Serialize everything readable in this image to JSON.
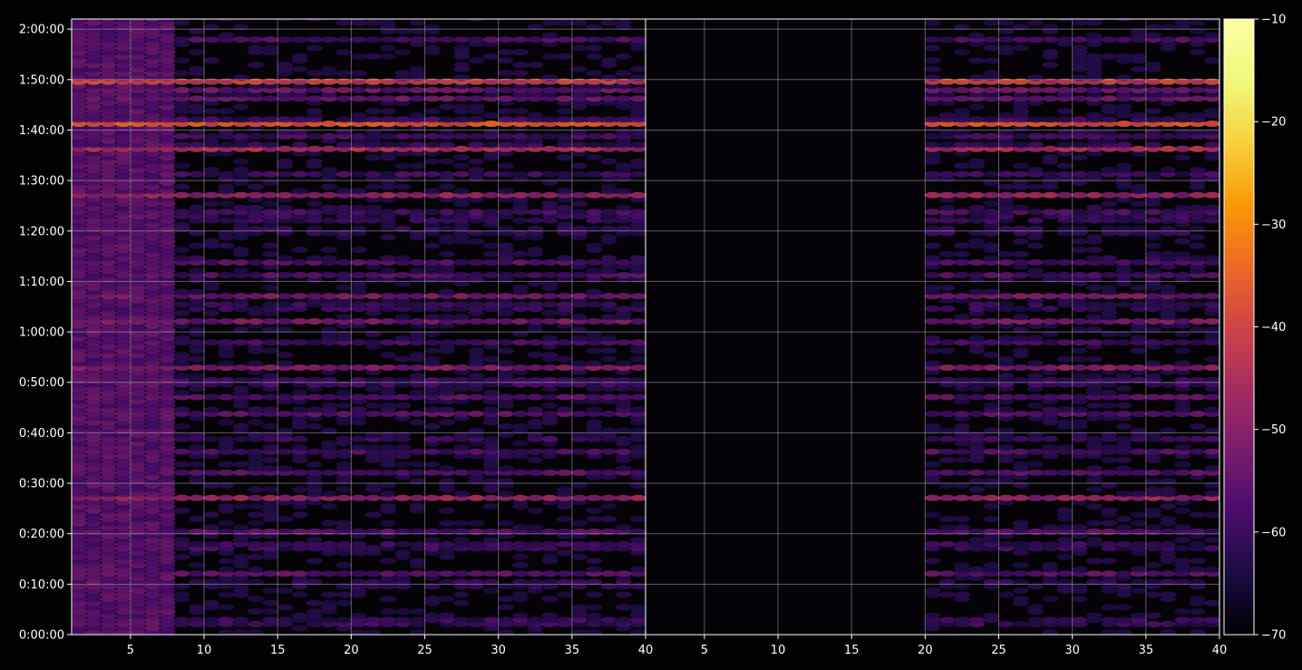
{
  "chart_data": {
    "type": "heatmap",
    "title": "",
    "xlabel": "",
    "ylabel": "",
    "colormap": "inferno",
    "background": "#000000",
    "grid": true,
    "panels": [
      {
        "name": "",
        "xlim": [
          1,
          40
        ],
        "x_ticks": [
          5,
          10,
          15,
          20,
          25,
          30,
          35,
          40
        ],
        "x_tick_labels": [
          "5",
          "10",
          "15",
          "20",
          "25",
          "30",
          "35",
          "40"
        ],
        "active_x_start": 1
      },
      {
        "name": "",
        "xlim": [
          1,
          40
        ],
        "x_ticks": [
          5,
          10,
          15,
          20,
          25,
          30,
          35,
          40
        ],
        "x_tick_labels": [
          "5",
          "10",
          "15",
          "20",
          "25",
          "30",
          "35",
          "40"
        ],
        "active_x_start": 20
      }
    ],
    "ylim_seconds": [
      0,
      7320
    ],
    "y_ticks_seconds": [
      0,
      600,
      1200,
      1800,
      2400,
      3000,
      3600,
      4200,
      4800,
      5400,
      6000,
      6600,
      7200
    ],
    "y_tick_labels": [
      "0:00:00",
      "0:10:00",
      "0:20:00",
      "0:30:00",
      "0:40:00",
      "0:50:00",
      "1:00:00",
      "1:10:00",
      "1:20:00",
      "1:30:00",
      "1:40:00",
      "1:50:00",
      "2:00:00"
    ],
    "colorbar": {
      "range": [
        -70,
        -10
      ],
      "ticks": [
        -70,
        -60,
        -50,
        -40,
        -30,
        -20,
        -10
      ],
      "tick_labels": [
        "−70",
        "−60",
        "−50",
        "−40",
        "−30",
        "−20",
        "−10"
      ]
    },
    "bands": [
      {
        "time": "0:02:30",
        "value": -52
      },
      {
        "time": "0:10:00",
        "value": -58
      },
      {
        "time": "0:12:00",
        "value": -55
      },
      {
        "time": "0:17:30",
        "value": -52
      },
      {
        "time": "0:20:30",
        "value": -56
      },
      {
        "time": "0:27:00",
        "value": -46
      },
      {
        "time": "0:32:00",
        "value": -55
      },
      {
        "time": "0:36:00",
        "value": -53
      },
      {
        "time": "0:39:00",
        "value": -58
      },
      {
        "time": "0:44:00",
        "value": -51
      },
      {
        "time": "0:47:00",
        "value": -56
      },
      {
        "time": "0:50:00",
        "value": -52
      },
      {
        "time": "0:53:00",
        "value": -49
      },
      {
        "time": "0:58:00",
        "value": -58
      },
      {
        "time": "1:02:00",
        "value": -51
      },
      {
        "time": "1:05:00",
        "value": -54
      },
      {
        "time": "1:07:00",
        "value": -51
      },
      {
        "time": "1:11:00",
        "value": -53
      },
      {
        "time": "1:14:00",
        "value": -52
      },
      {
        "time": "1:20:00",
        "value": -57
      },
      {
        "time": "1:22:30",
        "value": -54
      },
      {
        "time": "1:24:00",
        "value": -55
      },
      {
        "time": "1:27:00",
        "value": -46
      },
      {
        "time": "1:31:00",
        "value": -56
      },
      {
        "time": "1:36:30",
        "value": -33
      },
      {
        "time": "1:39:00",
        "value": -55
      },
      {
        "time": "1:41:30",
        "value": -20
      },
      {
        "time": "1:46:30",
        "value": -48
      },
      {
        "time": "1:48:00",
        "value": -53
      },
      {
        "time": "1:49:30",
        "value": -38
      },
      {
        "time": "1:58:00",
        "value": -57
      }
    ]
  }
}
